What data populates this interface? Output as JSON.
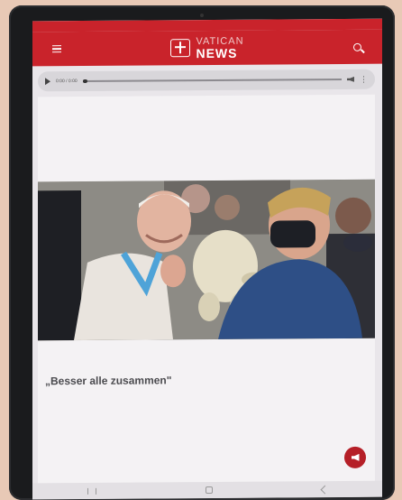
{
  "app": {
    "brand_line1": "VATICAN",
    "brand_line2": "NEWS",
    "menu_label": "",
    "search_label": ""
  },
  "player": {
    "elapsed": "0:00 / 0:00",
    "progress_fraction": 0.02
  },
  "article": {
    "intro": "",
    "caption": "",
    "headline": "„Besser alle zusammen\"",
    "body": ""
  },
  "colors": {
    "brand_red": "#c9232b",
    "fab_red": "#b51f27"
  },
  "icons": [
    "menu-icon",
    "search-icon",
    "play-icon",
    "volume-icon",
    "more-icon",
    "speaker-icon",
    "recent-apps-icon",
    "home-icon",
    "back-icon"
  ]
}
